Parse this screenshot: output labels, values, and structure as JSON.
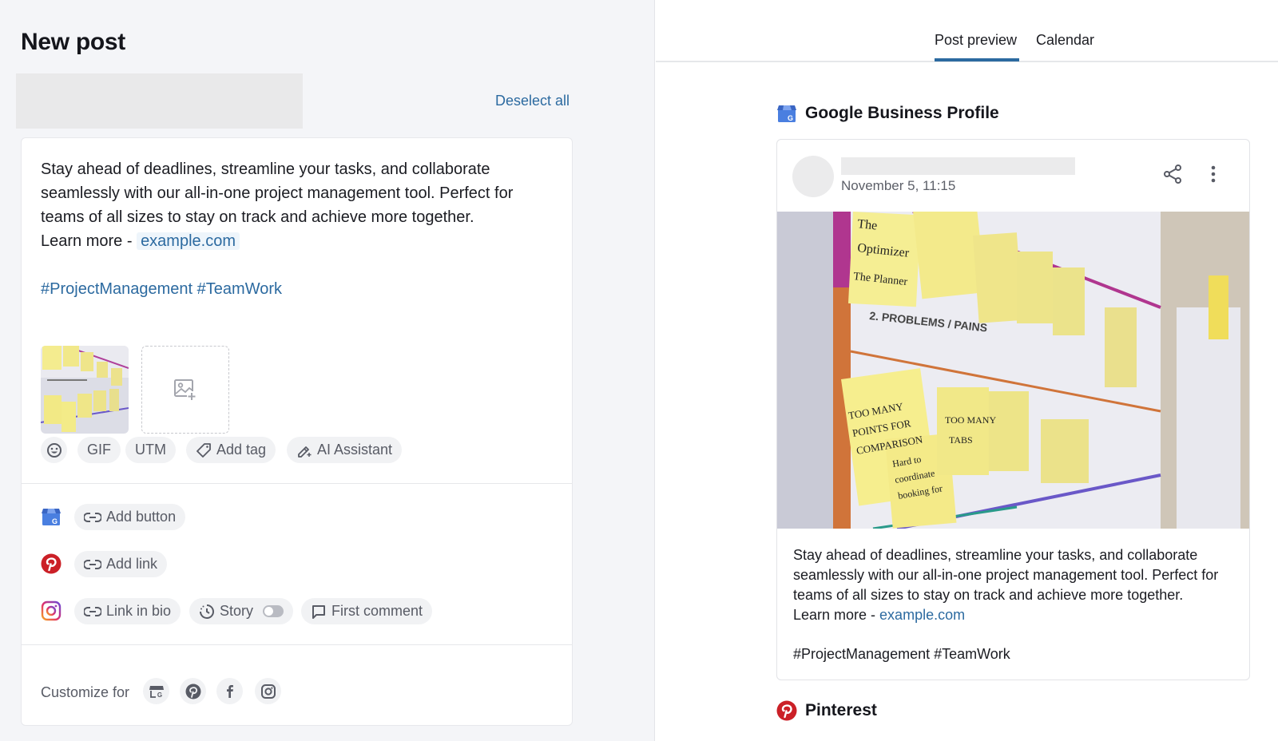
{
  "composer": {
    "title": "New post",
    "deselect_all": "Deselect all",
    "post": {
      "body": "Stay ahead of deadlines, streamline your tasks, and collaborate seamlessly with our all-in-one project management tool. Perfect for teams of all sizes to stay on track and achieve more together.",
      "learn_more_prefix": "Learn more - ",
      "link": "example.com",
      "hashtags": "#ProjectManagement #TeamWork"
    },
    "media": {
      "thumbnail_alt": "Sticky notes on a planning board",
      "add_media_icon": "image-plus-icon"
    },
    "toolbar": [
      {
        "id": "emoji",
        "label": "",
        "icon": "smiley-icon"
      },
      {
        "id": "gif",
        "label": "GIF",
        "icon": ""
      },
      {
        "id": "utm",
        "label": "UTM",
        "icon": ""
      },
      {
        "id": "add-tag",
        "label": "Add tag",
        "icon": "tag-icon"
      },
      {
        "id": "ai-assistant",
        "label": "AI Assistant",
        "icon": "magic-pen-icon"
      }
    ],
    "network_options": {
      "google_business": {
        "network": "Google Business Profile",
        "actions": [
          {
            "label": "Add button",
            "icon": "link-icon"
          }
        ]
      },
      "pinterest": {
        "network": "Pinterest",
        "actions": [
          {
            "label": "Add link",
            "icon": "link-icon"
          }
        ]
      },
      "instagram": {
        "network": "Instagram",
        "actions": [
          {
            "label": "Link in bio",
            "icon": "link-icon"
          },
          {
            "label": "Story",
            "icon": "clock-icon",
            "toggle": false
          },
          {
            "label": "First comment",
            "icon": "comment-icon"
          }
        ]
      }
    },
    "customize": {
      "label": "Customize for",
      "networks": [
        "google-business-icon",
        "pinterest-icon",
        "facebook-icon",
        "instagram-icon"
      ]
    }
  },
  "preview": {
    "tabs": [
      {
        "label": "Post preview",
        "active": true
      },
      {
        "label": "Calendar",
        "active": false
      }
    ],
    "sections": [
      {
        "network": "Google Business Profile",
        "date": "November 5, 11:15",
        "body": "Stay ahead of deadlines, streamline your tasks, and collaborate seamlessly with our all-in-one project management tool. Perfect for teams of all sizes to stay on track and achieve more together.",
        "learn_more_prefix": "Learn more - ",
        "link": "example.com",
        "hashtags": "#ProjectManagement #TeamWork"
      },
      {
        "network": "Pinterest"
      }
    ]
  },
  "colors": {
    "accent": "#2c6aa0",
    "panel_bg": "#f4f5f8",
    "chip_bg": "#f1f2f4",
    "pinterest_red": "#cb2027",
    "google_blue": "#4a7fe0"
  }
}
